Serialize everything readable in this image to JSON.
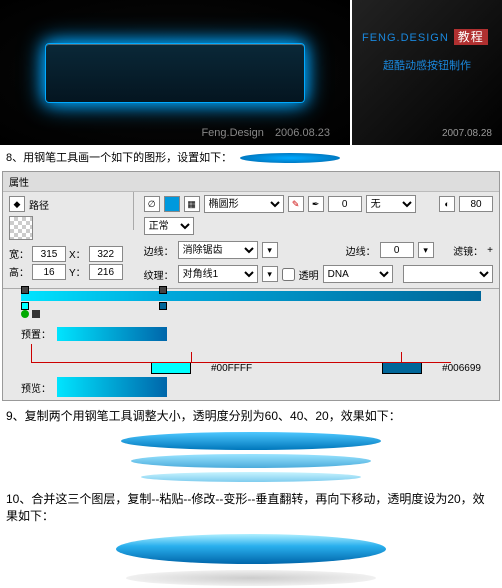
{
  "header": {
    "left_footer_brand": "Feng.Design",
    "left_footer_date": "2006.08.23",
    "right_brand": "FENG.DESIGN",
    "right_tutorial": "教程",
    "right_subtitle": "超酷动感按钮制作",
    "right_date": "2007.08.28"
  },
  "steps": {
    "s8": "8、用钢笔工具画一个如下的图形，设置如下：",
    "s9": "9、复制两个用钢笔工具调整大小，透明度分别为60、40、20，效果如下：",
    "s10": "10、合并这三个图层，复制--粘贴--修改--变形--垂直翻转，再向下移动，透明度设为20，效果如下："
  },
  "attr_panel": {
    "title": "属性",
    "path_label": "路径",
    "shape_type": "椭圆形",
    "edge_label": "边线：",
    "edge_mode": "消除锯齿",
    "texture_label": "纹理：",
    "texture_mode": "对角线1",
    "transparent": "透明",
    "stroke_label": "边线：",
    "stroke_val": "0",
    "none": "无",
    "dna": "DNA",
    "opacity_val": "80",
    "blend": "正常",
    "filter_label": "滤镜：",
    "plus": "+"
  },
  "dims": {
    "w_label": "宽：",
    "w": "315",
    "h_label": "高：",
    "h": "16",
    "x_label": "X：",
    "x": "322",
    "y_label": "Y：",
    "y": "216"
  },
  "grad": {
    "preset_label": "预置：",
    "preview_label": "预览：",
    "color1": "#00FFFF",
    "color2": "#006699"
  }
}
